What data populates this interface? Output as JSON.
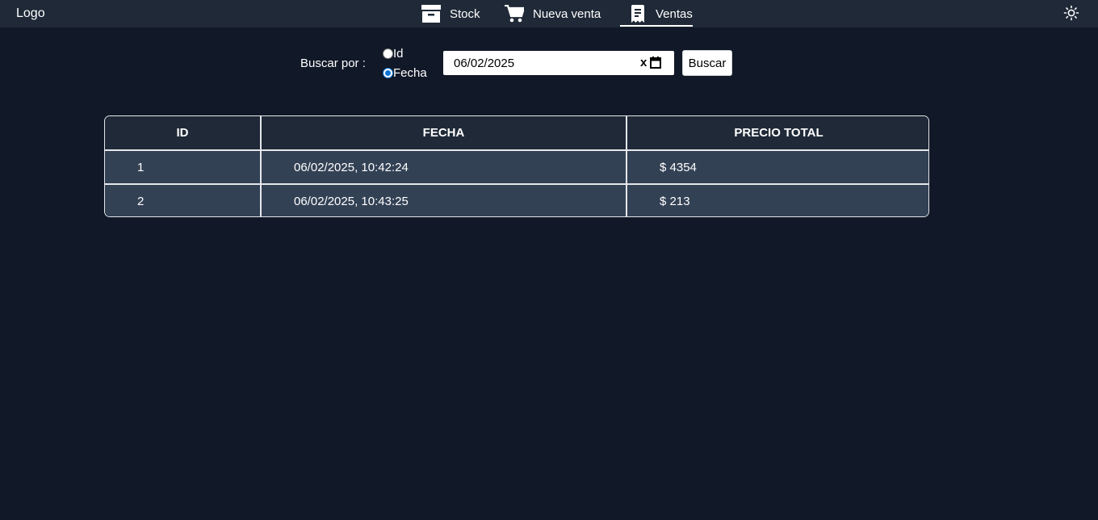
{
  "header": {
    "logo": "Logo",
    "nav": [
      {
        "label": "Stock",
        "icon": "archive-box-icon"
      },
      {
        "label": "Nueva venta",
        "icon": "shopping-cart-icon"
      },
      {
        "label": "Ventas",
        "icon": "receipt-icon",
        "active": true
      }
    ],
    "theme_icon": "sun-icon"
  },
  "search": {
    "label": "Buscar por :",
    "options": [
      {
        "label": "Id",
        "checked": false
      },
      {
        "label": "Fecha",
        "checked": true
      }
    ],
    "date_value": "06/02/2025",
    "button_label": "Buscar"
  },
  "table": {
    "columns": [
      "ID",
      "FECHA",
      "PRECIO TOTAL"
    ],
    "rows": [
      {
        "id": "1",
        "fecha": "06/02/2025, 10:42:24",
        "precio": "$ 4354"
      },
      {
        "id": "2",
        "fecha": "06/02/2025, 10:43:25",
        "precio": "$ 213"
      }
    ]
  },
  "colors": {
    "background": "#111827",
    "navbar": "#1f2937",
    "row": "#334155",
    "radio_accent": "#0a74d6"
  }
}
